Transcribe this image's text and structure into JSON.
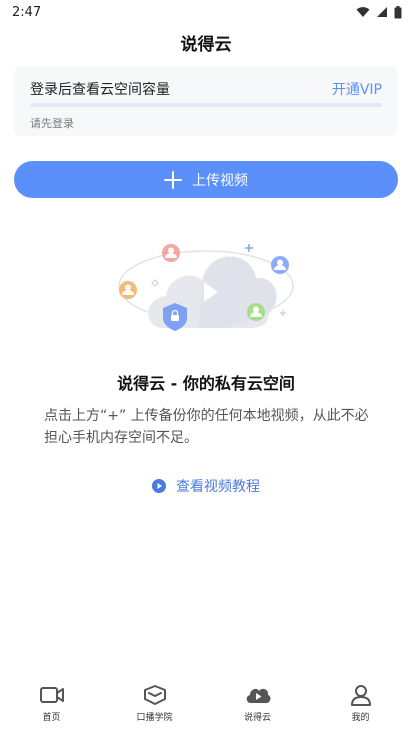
{
  "status_bar": {
    "time": "2:47"
  },
  "header": {
    "title": "说得云"
  },
  "storage": {
    "title": "登录后查看云空间容量",
    "vip_label": "开通VIP",
    "login_hint": "请先登录",
    "usage_fraction": 0
  },
  "upload": {
    "label": "上传视频"
  },
  "empty_state": {
    "title": "说得云 - 你的私有云空间",
    "description": "点击上方“+” 上传备份你的任何本地视频，从此不必担心手机内存空间不足。",
    "tutorial_label": "查看视频教程"
  },
  "tabs": [
    {
      "label": "首页",
      "icon": "video-camera-icon"
    },
    {
      "label": "口播学院",
      "icon": "graduation-cap-icon"
    },
    {
      "label": "说得云",
      "icon": "cloud-play-icon",
      "active": true
    },
    {
      "label": "我的",
      "icon": "user-icon"
    }
  ],
  "colors": {
    "accent": "#5b8ff9",
    "link": "#4a7be0",
    "card_bg": "#f7f8fa",
    "tab_icon": "#555555"
  }
}
